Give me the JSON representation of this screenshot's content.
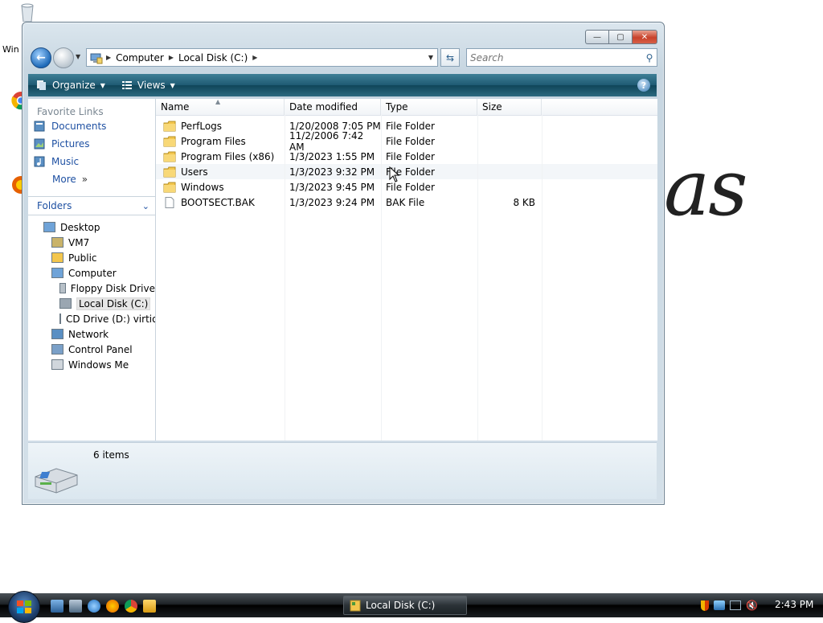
{
  "desktop": {
    "background_text": "as",
    "icon_label_fragment": "Win"
  },
  "window": {
    "title_buttons": {
      "minimize": "—",
      "maximize": "▢",
      "close": "✕"
    },
    "address": {
      "crumbs": [
        "Computer",
        "Local Disk (C:)"
      ]
    },
    "search": {
      "placeholder": "Search"
    },
    "toolbar": {
      "organize": "Organize",
      "views": "Views",
      "help": "?"
    },
    "favorite_links": {
      "title": "Favorite Links",
      "items": [
        "Documents",
        "Pictures",
        "Music"
      ],
      "more": "More"
    },
    "folders": {
      "title": "Folders",
      "tree": [
        {
          "label": "Desktop",
          "level": 0
        },
        {
          "label": "VM7",
          "level": 1
        },
        {
          "label": "Public",
          "level": 1
        },
        {
          "label": "Computer",
          "level": 1
        },
        {
          "label": "Floppy Disk Drive",
          "level": 2
        },
        {
          "label": "Local Disk (C:)",
          "level": 2,
          "selected": true
        },
        {
          "label": "CD Drive (D:) virtio",
          "level": 2
        },
        {
          "label": "Network",
          "level": 1
        },
        {
          "label": "Control Panel",
          "level": 1
        },
        {
          "label": "Windows Me",
          "level": 1
        }
      ]
    },
    "columns": [
      "Name",
      "Date modified",
      "Type",
      "Size"
    ],
    "files": [
      {
        "name": "PerfLogs",
        "date": "1/20/2008 7:05 PM",
        "type": "File Folder",
        "size": "",
        "kind": "folder"
      },
      {
        "name": "Program Files",
        "date": "11/2/2006 7:42 AM",
        "type": "File Folder",
        "size": "",
        "kind": "folder"
      },
      {
        "name": "Program Files (x86)",
        "date": "1/3/2023 1:55 PM",
        "type": "File Folder",
        "size": "",
        "kind": "folder"
      },
      {
        "name": "Users",
        "date": "1/3/2023 9:32 PM",
        "type": "File Folder",
        "size": "",
        "kind": "folder",
        "hover": true
      },
      {
        "name": "Windows",
        "date": "1/3/2023 9:45 PM",
        "type": "File Folder",
        "size": "",
        "kind": "folder"
      },
      {
        "name": "BOOTSECT.BAK",
        "date": "1/3/2023 9:24 PM",
        "type": "BAK File",
        "size": "8 KB",
        "kind": "file"
      }
    ],
    "details": {
      "count": "6 items"
    }
  },
  "taskbar": {
    "task_label": "Local Disk (C:)",
    "clock": "2:43 PM"
  },
  "colors": {
    "link_blue": "#1e50a2",
    "toolbar_teal": "#1f5a73",
    "folder_yellow": "#f3c64d"
  }
}
